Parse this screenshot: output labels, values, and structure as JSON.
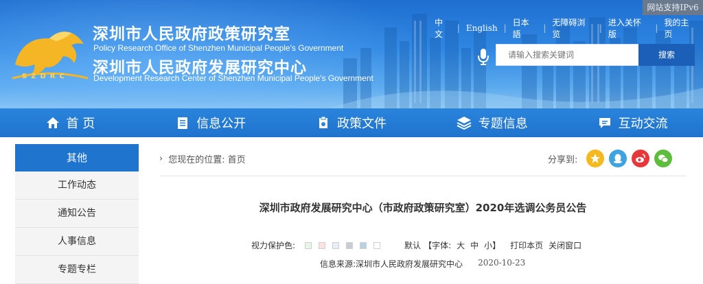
{
  "header": {
    "title_cn_1": "深圳市人民政府政策研究室",
    "title_en_1": "Policy Research Office of Shenzhen Municipal People's Government",
    "title_cn_2": "深圳市人民政府发展研究中心",
    "title_en_2": "Development Research Center of Shenzhen Municipal People's Government",
    "logo_text": "SZDRC",
    "ipv6_badge": "网站支持IPv6",
    "toplinks": [
      "中文",
      "English",
      "日本語",
      "无障碍浏览",
      "进入关怀版",
      "我的主页"
    ],
    "search": {
      "placeholder": "请输入搜索关键词",
      "button_label": "搜索"
    }
  },
  "nav": {
    "items": [
      {
        "label": "首 页",
        "icon": "home-icon"
      },
      {
        "label": "信息公开",
        "icon": "document-icon"
      },
      {
        "label": "政策文件",
        "icon": "policy-icon"
      },
      {
        "label": "专题信息",
        "icon": "layers-icon"
      },
      {
        "label": "互动交流",
        "icon": "chat-icon"
      }
    ]
  },
  "sidebar": {
    "heading": "其他",
    "items": [
      "工作动态",
      "通知公告",
      "人事信息",
      "专题专栏"
    ]
  },
  "breadcrumb": {
    "prefix": "您现在的位置:",
    "home": "首页"
  },
  "share": {
    "label": "分享到:",
    "icons": [
      "qzone-icon",
      "qq-icon",
      "weibo-icon",
      "wechat-icon"
    ]
  },
  "article": {
    "title": "深圳市政府发展研究中心（市政府政策研究室）2020年选调公务员公告",
    "tools": {
      "eye_label": "视力保护色:",
      "swatch_colors": [
        "#e6f5e6",
        "#fbe3e3",
        "#e7eef8",
        "#c8ccd1",
        "#b7d2e3",
        "#ffffff"
      ],
      "default_label": "默认",
      "font_label": "【字体:",
      "font_large": "大",
      "font_medium": "中",
      "font_small": "小】",
      "print_label": "打印本页",
      "close_label": "关闭窗口"
    },
    "source_label": "信息来源:",
    "source": "深圳市人民政府发展研究中心",
    "date": "2020-10-23"
  },
  "colors": {
    "brand_blue": "#1f74cd",
    "nav_blue": "#2a84dc",
    "search_btn": "#1b5fb9"
  }
}
